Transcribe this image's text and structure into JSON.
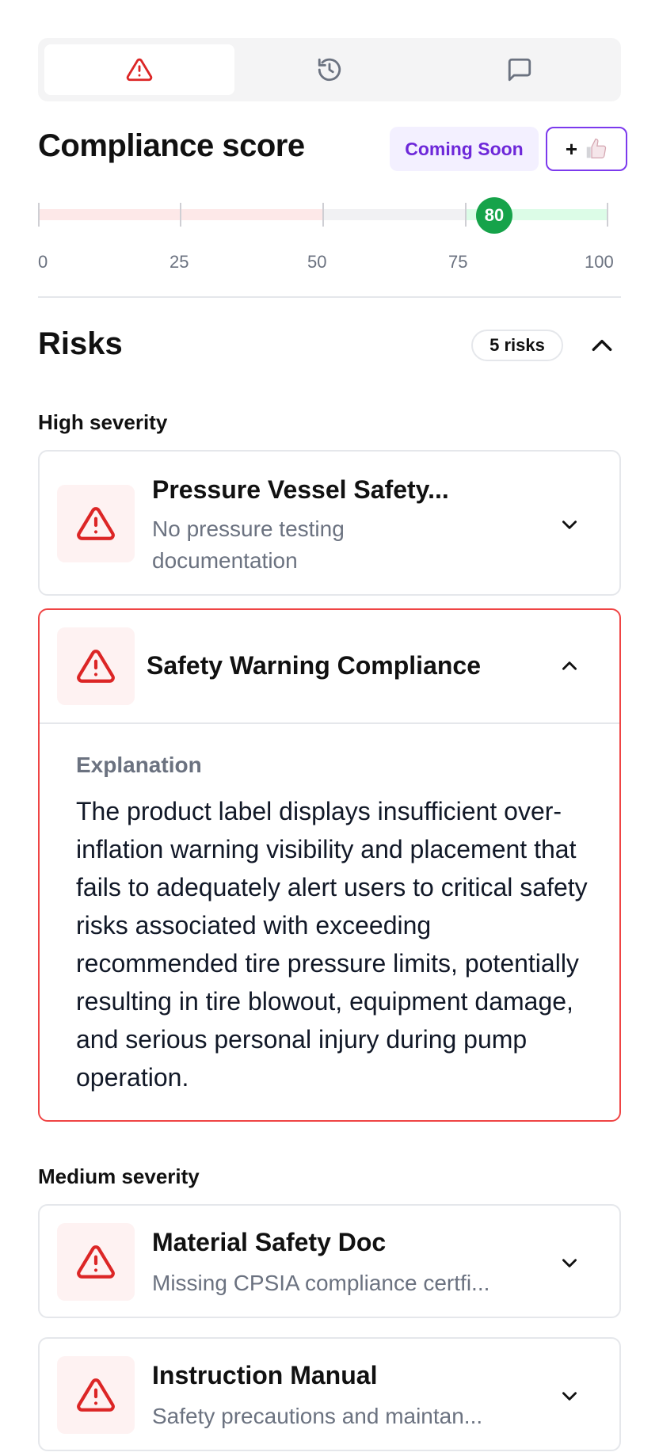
{
  "tabs": [
    {
      "icon": "alert-triangle-icon",
      "active": true
    },
    {
      "icon": "history-icon",
      "active": false
    },
    {
      "icon": "message-icon",
      "active": false
    }
  ],
  "score": {
    "title": "Compliance score",
    "coming_soon": "Coming Soon",
    "plus_label": "+",
    "value": 80,
    "ticks": [
      "0",
      "25",
      "50",
      "75",
      "100"
    ]
  },
  "risks": {
    "title": "Risks",
    "count_label": "5 risks",
    "high_label": "High severity",
    "medium_label": "Medium severity",
    "items": [
      {
        "title": "Pressure Vessel Safety...",
        "subtitle": "No pressure testing documentation"
      },
      {
        "title": "Safety Warning Compliance",
        "explanation_label": "Explanation",
        "explanation": "The product label displays insufficient over-inflation warning visibility and placement that fails to adequately alert users to critical safety risks associated with exceeding recommended tire pressure limits, potentially resulting in tire blowout, equipment damage, and serious personal injury during pump operation."
      },
      {
        "title": "Material Safety Doc",
        "subtitle": "Missing CPSIA compliance certfi..."
      },
      {
        "title": "Instruction Manual",
        "subtitle": "Safety precautions and maintan..."
      }
    ]
  },
  "colors": {
    "danger": "#dc2626",
    "accent": "#7c3aed",
    "success": "#16a34a"
  }
}
